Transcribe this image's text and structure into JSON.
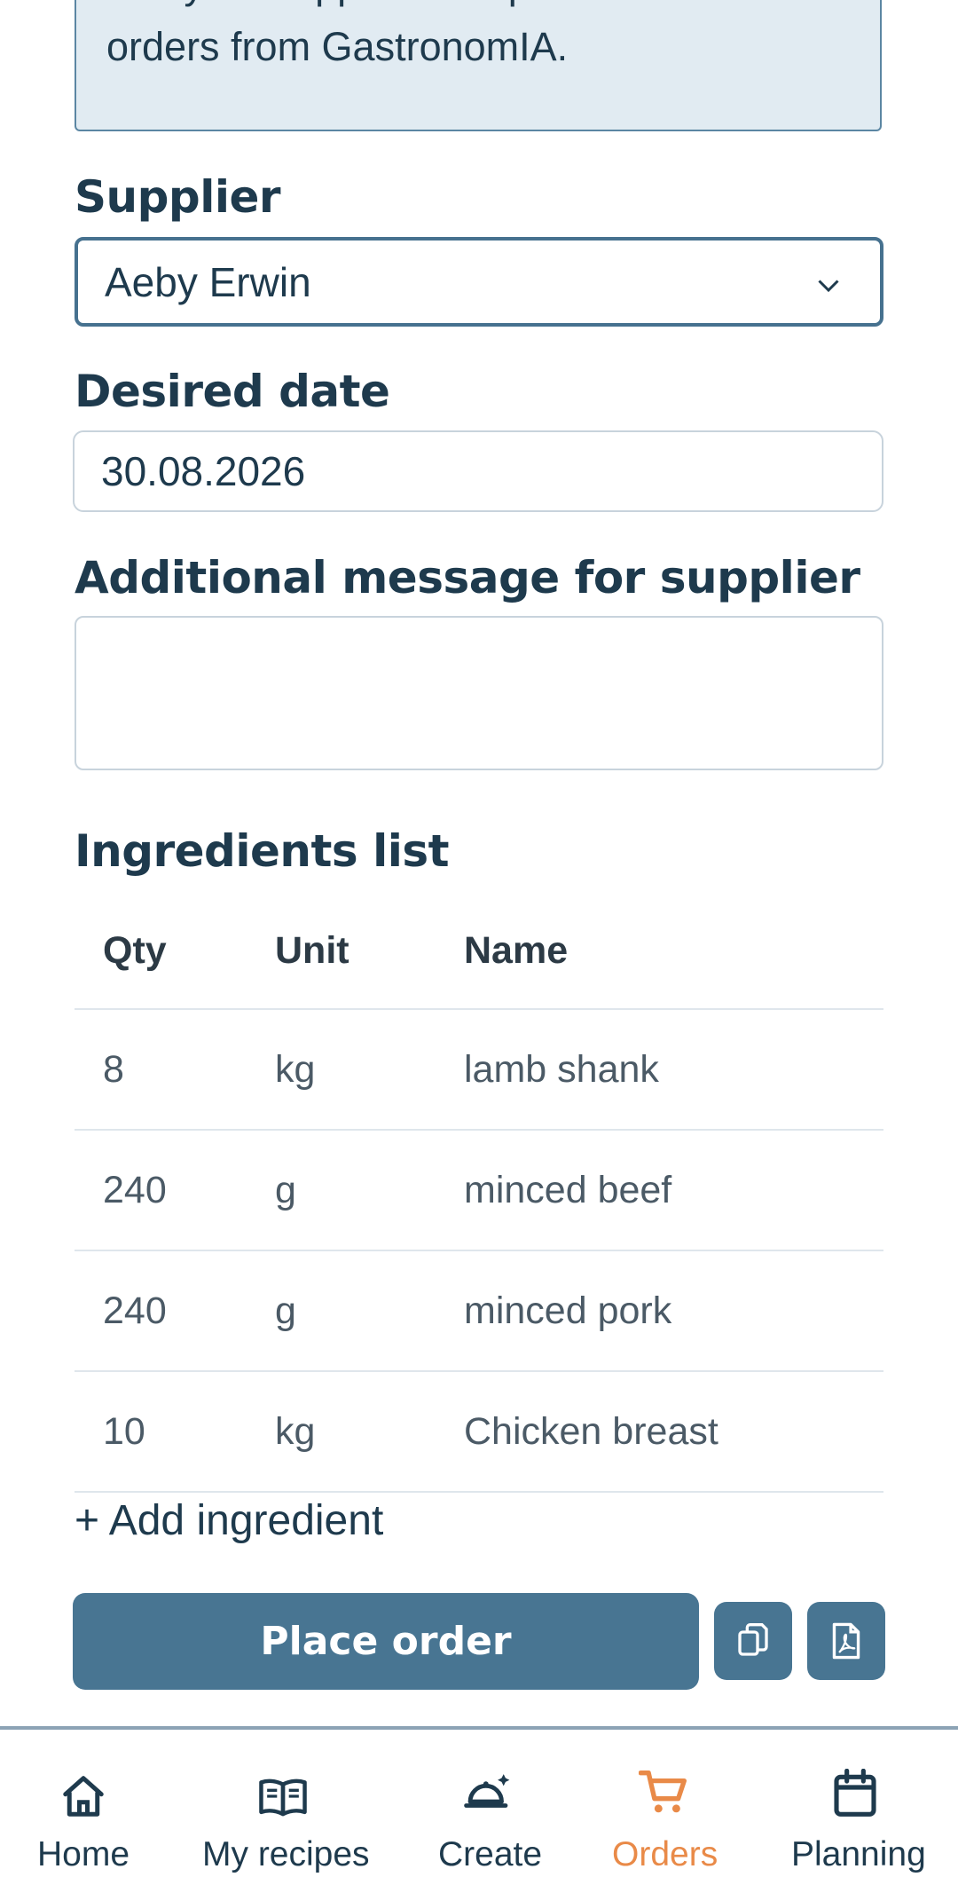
{
  "info": {
    "line1": "that your supplier accepts email",
    "line2": "orders from GastronomIA."
  },
  "supplier": {
    "label": "Supplier",
    "value": "Aeby Erwin"
  },
  "date": {
    "label": "Desired date",
    "value": "30.08.2026"
  },
  "message": {
    "label": "Additional message for supplier",
    "value": ""
  },
  "ingredients": {
    "title": "Ingredients list",
    "columns": {
      "qty": "Qty",
      "unit": "Unit",
      "name": "Name"
    },
    "rows": [
      {
        "qty": "8",
        "unit": "kg",
        "name": "lamb shank"
      },
      {
        "qty": "240",
        "unit": "g",
        "name": "minced beef"
      },
      {
        "qty": "240",
        "unit": "g",
        "name": "minced pork"
      },
      {
        "qty": "10",
        "unit": "kg",
        "name": "Chicken breast"
      }
    ],
    "add_label": "+ Add ingredient"
  },
  "actions": {
    "place_order": "Place order",
    "copy_icon": "copy-icon",
    "pdf_icon": "pdf-icon"
  },
  "nav": {
    "items": [
      {
        "label": "Home",
        "icon": "home-icon"
      },
      {
        "label": "My recipes",
        "icon": "book-icon"
      },
      {
        "label": "Create",
        "icon": "cloche-icon"
      },
      {
        "label": "Orders",
        "icon": "cart-icon",
        "active": true
      },
      {
        "label": "Planning",
        "icon": "calendar-icon"
      }
    ]
  },
  "colors": {
    "primary": "#487592",
    "text": "#1e3a4d",
    "active": "#e98a48",
    "info_bg": "#e1ebf2"
  }
}
